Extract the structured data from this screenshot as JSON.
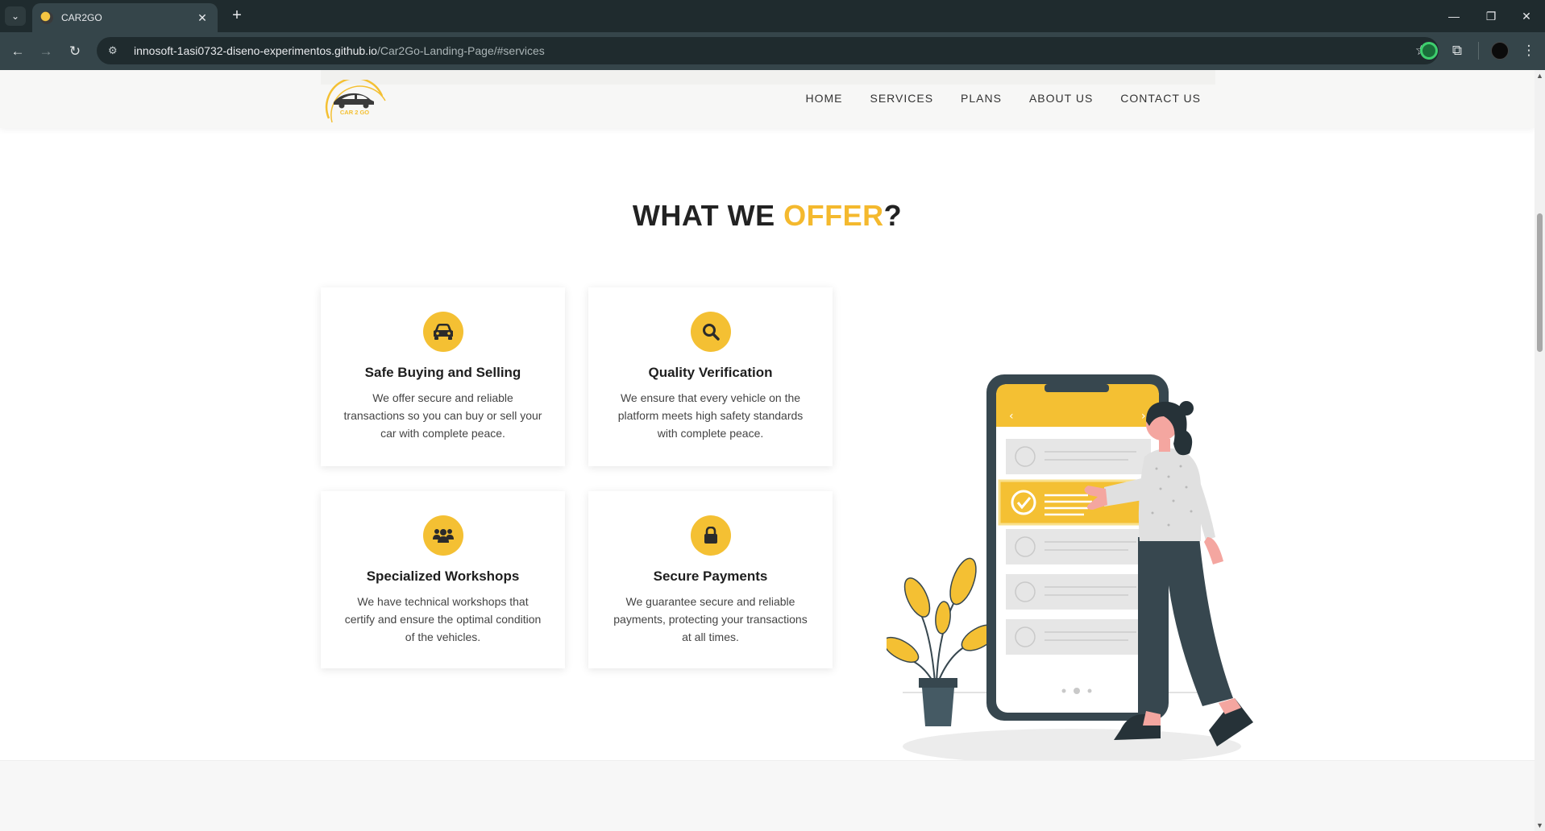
{
  "browser": {
    "tab_title": "CAR2GO",
    "url_host": "innosoft-1asi0732-diseno-experimentos.github.io",
    "url_path": "/Car2Go-Landing-Page/#services"
  },
  "header": {
    "logo_text": "CAR 2 GO",
    "nav": [
      "HOME",
      "SERVICES",
      "PLANS",
      "ABOUT US",
      "CONTACT US"
    ]
  },
  "section": {
    "title_part1": "WHAT WE ",
    "title_accent": "OFFER",
    "title_end": "?"
  },
  "cards": [
    {
      "icon": "car-icon",
      "title": "Safe Buying and Selling",
      "text": "We offer secure and reliable transactions so you can buy or sell your car with complete peace."
    },
    {
      "icon": "search-icon",
      "title": "Quality Verification",
      "text": "We ensure that every vehicle on the platform meets high safety standards with complete peace."
    },
    {
      "icon": "users-icon",
      "title": "Specialized Workshops",
      "text": "We have technical workshops that certify and ensure the optimal condition of the vehicles."
    },
    {
      "icon": "lock-icon",
      "title": "Secure Payments",
      "text": "We guarantee secure and reliable payments, protecting your transactions at all times."
    }
  ],
  "colors": {
    "accent": "#f4b92e",
    "icon_bg": "#f4c033",
    "chrome_dark": "#1f2b2e",
    "illustration_dark": "#37474f"
  }
}
